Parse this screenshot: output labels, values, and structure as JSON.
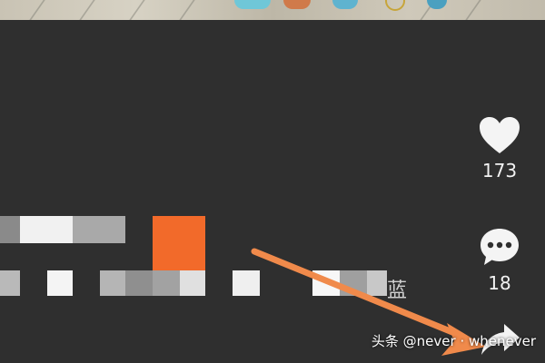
{
  "actions": {
    "like": {
      "icon": "heart-icon",
      "count": "173"
    },
    "comment": {
      "icon": "comment-bubble-icon",
      "count": "18"
    },
    "share": {
      "icon": "share-arrow-icon"
    }
  },
  "caption": {
    "visible_char": "蓝"
  },
  "watermark": {
    "text": "头条 @never · whenever"
  },
  "colors": {
    "background": "#2f2f2f",
    "accent_block": "#f26a2a",
    "arrow": "#f08a4b",
    "text": "#f2f2f2"
  }
}
